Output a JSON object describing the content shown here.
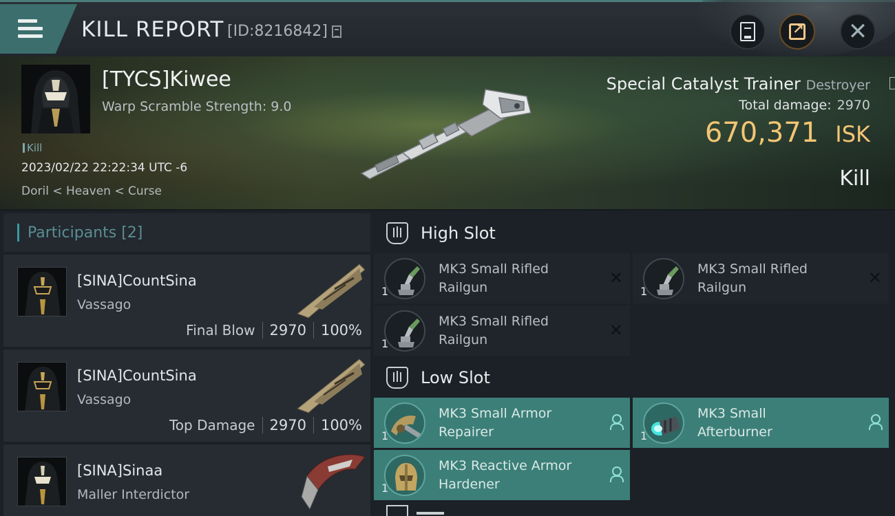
{
  "header": {
    "title": "KILL REPORT",
    "id_label": "[ID:8216842]"
  },
  "victim": {
    "name": "[TYCS]Kiwee",
    "subtitle": "Warp Scramble Strength: 9.0",
    "tag": "Kill",
    "timestamp": "2023/02/22 22:22:34 UTC -6",
    "location": "Doril < Heaven < Curse",
    "ship_name": "Special Catalyst Trainer",
    "ship_class": "Destroyer",
    "total_damage_label": "Total damage:",
    "total_damage": "2970",
    "isk_value": "670,371",
    "isk_unit": "ISK",
    "result": "Kill"
  },
  "participants": {
    "header": "Participants [2]",
    "rows": [
      {
        "name": "[SINA]CountSina",
        "ship": "Vassago",
        "label": "Final Blow",
        "damage": "2970",
        "percent": "100%"
      },
      {
        "name": "[SINA]CountSina",
        "ship": "Vassago",
        "label": "Top Damage",
        "damage": "2970",
        "percent": "100%"
      },
      {
        "name": "[SINA]Sinaa",
        "ship": "Maller Interdictor"
      }
    ]
  },
  "fitting": {
    "high_slot": {
      "title": "High Slot",
      "modules": [
        {
          "name": "MK3 Small Rifled Railgun",
          "qty": "1"
        },
        {
          "name": "MK3 Small Rifled Railgun",
          "qty": "1"
        },
        {
          "name": "MK3 Small Rifled Railgun",
          "qty": "1"
        }
      ]
    },
    "low_slot": {
      "title": "Low Slot",
      "modules": [
        {
          "name": "MK3 Small Armor Repairer",
          "qty": "1"
        },
        {
          "name": "MK3 Small Afterburner",
          "qty": "1"
        },
        {
          "name": "MK3 Reactive Armor Hardener",
          "qty": "1"
        }
      ]
    }
  },
  "icons": {
    "menu": "hamburger-menu-icon",
    "copy": "copy-icon",
    "report": "clipboard-icon",
    "share": "external-share-icon",
    "close": "close-icon",
    "slot": "slot-shield-icon",
    "destroyed": "destroyed-x-icon",
    "dropped": "pilot-icon"
  },
  "colors": {
    "accent": "#3c7f78",
    "isk": "#f2c574",
    "participants_header": "#5a8d93"
  }
}
